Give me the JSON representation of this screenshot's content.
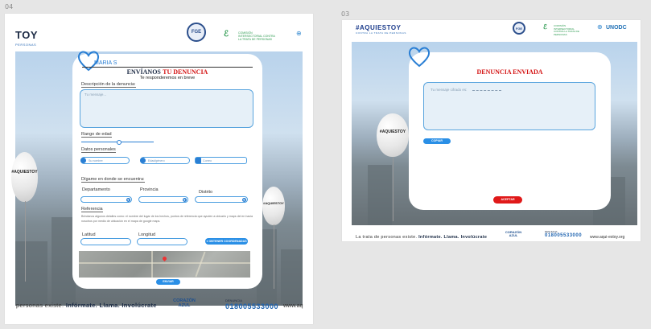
{
  "labels": {
    "left": "04",
    "right": "03"
  },
  "left": {
    "brand": {
      "logo": "TOY",
      "sub": "PERSONAS"
    },
    "seal_text": "FGE",
    "ci_text": "COMISIÓN INTERSECTORIAL CONTRA LA TRATA DE PERSONAS",
    "card": {
      "name": "MARIA S",
      "title_prefix": "ENVÍANOS",
      "title_red": "TU DENUNCIA",
      "subtitle": "Te responderemos en breve",
      "desc_label": "Descripción de la denuncia:",
      "desc_placeholder": "Tu mensaje...",
      "age_label": "Rango de edad",
      "people_label": "Datos personales",
      "fields": [
        {
          "icon": "A",
          "placeholder": "Su nombre"
        },
        {
          "icon": "B",
          "placeholder": "Edad/género"
        },
        {
          "icon": "C",
          "placeholder": "Correo"
        }
      ],
      "location_label": "Dígame en donde se encuentra:",
      "dept_label": "Departamento",
      "prov_label": "Provincia",
      "dist_label": "Distrito",
      "ref_label": "Referencia",
      "ref_text": "Brindanos algunos detalles como: el nombre del lugar de los hechos, puntos de referencia que ayuden a ubicarlo y maps del en hacia nosotros por medio de ubicación en el mapa de google maps.",
      "lat_label": "Latitud",
      "lng_label": "Longitud",
      "coords_btn": "OBTENER COORDENADAS",
      "send_btn": "ENVIAR"
    },
    "balloon_text": "#AQUIESTOY",
    "footer": {
      "text_a": "personas existe.",
      "text_b": "Infórmate. Llama. Involúcrate",
      "corazon": "CORAZÓN AZUL",
      "denuncia": "DENUNCIA",
      "phone": "018005533000",
      "web": "www.aq"
    }
  },
  "right": {
    "brand": "#AQUIESTOY",
    "brand_sub": "CONTRA LA TRATA DE PERSONAS",
    "unodc": "UNODC",
    "card": {
      "title": "DENUNCIA ENVIADA",
      "msg_placeholder": "Tu mensaje cifrado es:",
      "btn_copy": "COPIAR",
      "btn_accept": "ACEPTAR"
    },
    "balloon_text": "#AQUIESTOY",
    "footer": {
      "text_a": "La trata de personas existe.",
      "text_b": "Infórmate. Llama. Involúcrate",
      "corazon": "CORAZÓN AZUL",
      "denuncia": "DENUNCIA",
      "phone": "018005533000",
      "web": "www.aqui-estoy.org"
    }
  }
}
